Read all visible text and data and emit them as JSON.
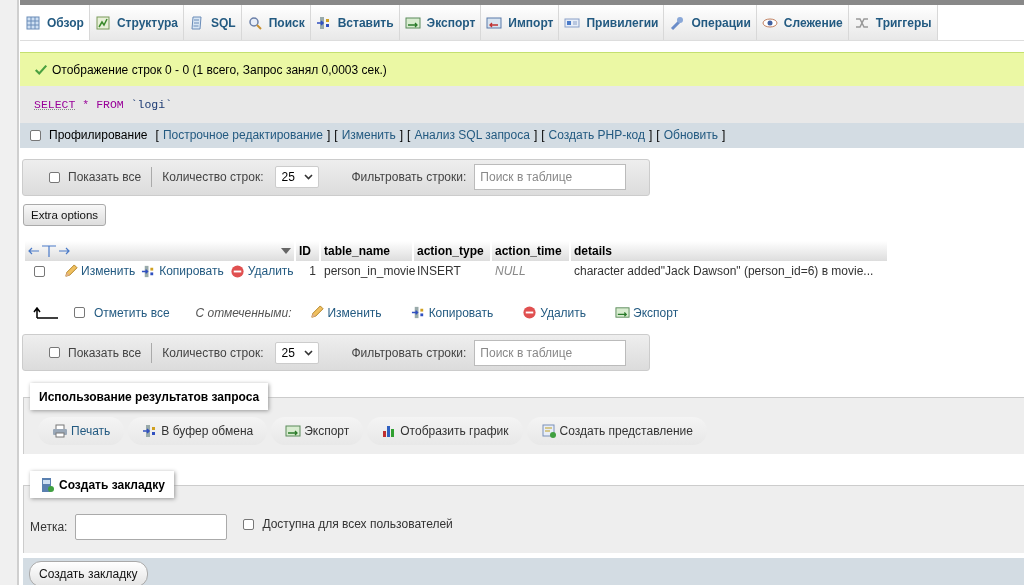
{
  "tabs": [
    {
      "label": "Обзор",
      "kind": "browse",
      "selected": true
    },
    {
      "label": "Структура",
      "kind": "structure",
      "selected": false
    },
    {
      "label": "SQL",
      "kind": "sql",
      "selected": false
    },
    {
      "label": "Поиск",
      "kind": "search",
      "selected": false
    },
    {
      "label": "Вставить",
      "kind": "insert",
      "selected": false
    },
    {
      "label": "Экспорт",
      "kind": "export",
      "selected": false
    },
    {
      "label": "Импорт",
      "kind": "import",
      "selected": false
    },
    {
      "label": "Привилегии",
      "kind": "privileges",
      "selected": false
    },
    {
      "label": "Операции",
      "kind": "operations",
      "selected": false
    },
    {
      "label": "Слежение",
      "kind": "tracking",
      "selected": false
    },
    {
      "label": "Триггеры",
      "kind": "triggers",
      "selected": false
    }
  ],
  "message": {
    "kind": "success",
    "text": "Отображение строк 0 - 0 (1 всего, Запрос занял 0,0003 сек.)"
  },
  "sql": {
    "keyword_1": "SELECT",
    "operator": "*",
    "keyword_2": "FROM",
    "table": "`logi`"
  },
  "profiling": {
    "label": "Профилирование",
    "checked": false,
    "links": [
      {
        "open": "[",
        "label": "Построчное редактирование",
        "close": "]"
      },
      {
        "open": "[",
        "label": "Изменить",
        "close": "]"
      },
      {
        "open": "[",
        "label": "Анализ SQL запроса",
        "close": "]"
      },
      {
        "open": "[",
        "label": "Создать PHP-код",
        "close": "]"
      },
      {
        "open": "[",
        "label": "Обновить",
        "close": "]"
      }
    ]
  },
  "navbars": [
    {
      "show_all": "Показать все",
      "checked": false,
      "rows_label": "Количество строк:",
      "rows_value": "25",
      "filter_label": "Фильтровать строки:",
      "filter_placeholder": "Поиск в таблице"
    },
    {
      "show_all": "Показать все",
      "checked": false,
      "rows_label": "Количество строк:",
      "rows_value": "25",
      "filter_label": "Фильтровать строки:",
      "filter_placeholder": "Поиск в таблице"
    }
  ],
  "extra_options": "Extra options",
  "table": {
    "columns": [
      "ID",
      "table_name",
      "action_type",
      "action_time",
      "details"
    ],
    "rows": [
      {
        "checked": false,
        "actions": [
          {
            "label": "Изменить",
            "kind": "edit"
          },
          {
            "label": "Копировать",
            "kind": "copy"
          },
          {
            "label": "Удалить",
            "kind": "delete"
          }
        ],
        "cells": [
          {
            "text": "1",
            "null": false
          },
          {
            "text": "person_in_movie",
            "null": false
          },
          {
            "text": "INSERT",
            "null": false
          },
          {
            "text": "NULL",
            "null": true
          },
          {
            "text": "character added\"Jack Dawson\" (person_id=6) в movie...",
            "null": false
          }
        ]
      }
    ]
  },
  "bulk": {
    "check_all": "Отметить все",
    "checked": false,
    "with_selected": "С отмеченными:",
    "actions": [
      {
        "label": "Изменить",
        "kind": "edit"
      },
      {
        "label": "Копировать",
        "kind": "copy"
      },
      {
        "label": "Удалить",
        "kind": "delete"
      },
      {
        "label": "Экспорт",
        "kind": "export"
      }
    ]
  },
  "query_results": {
    "legend": "Использование результатов запроса",
    "actions": [
      {
        "label": "Печать",
        "kind": "print"
      },
      {
        "label": "В буфер обмена",
        "kind": "copy"
      },
      {
        "label": "Экспорт",
        "kind": "export"
      },
      {
        "label": "Отобразить график",
        "kind": "chart"
      },
      {
        "label": "Создать представление",
        "kind": "view"
      }
    ]
  },
  "bookmark": {
    "legend": "Создать закладку",
    "label_field": "Метка:",
    "shared_label": "Доступна для всех пользователей",
    "shared_checked": false,
    "submit": "Создать закладку"
  }
}
